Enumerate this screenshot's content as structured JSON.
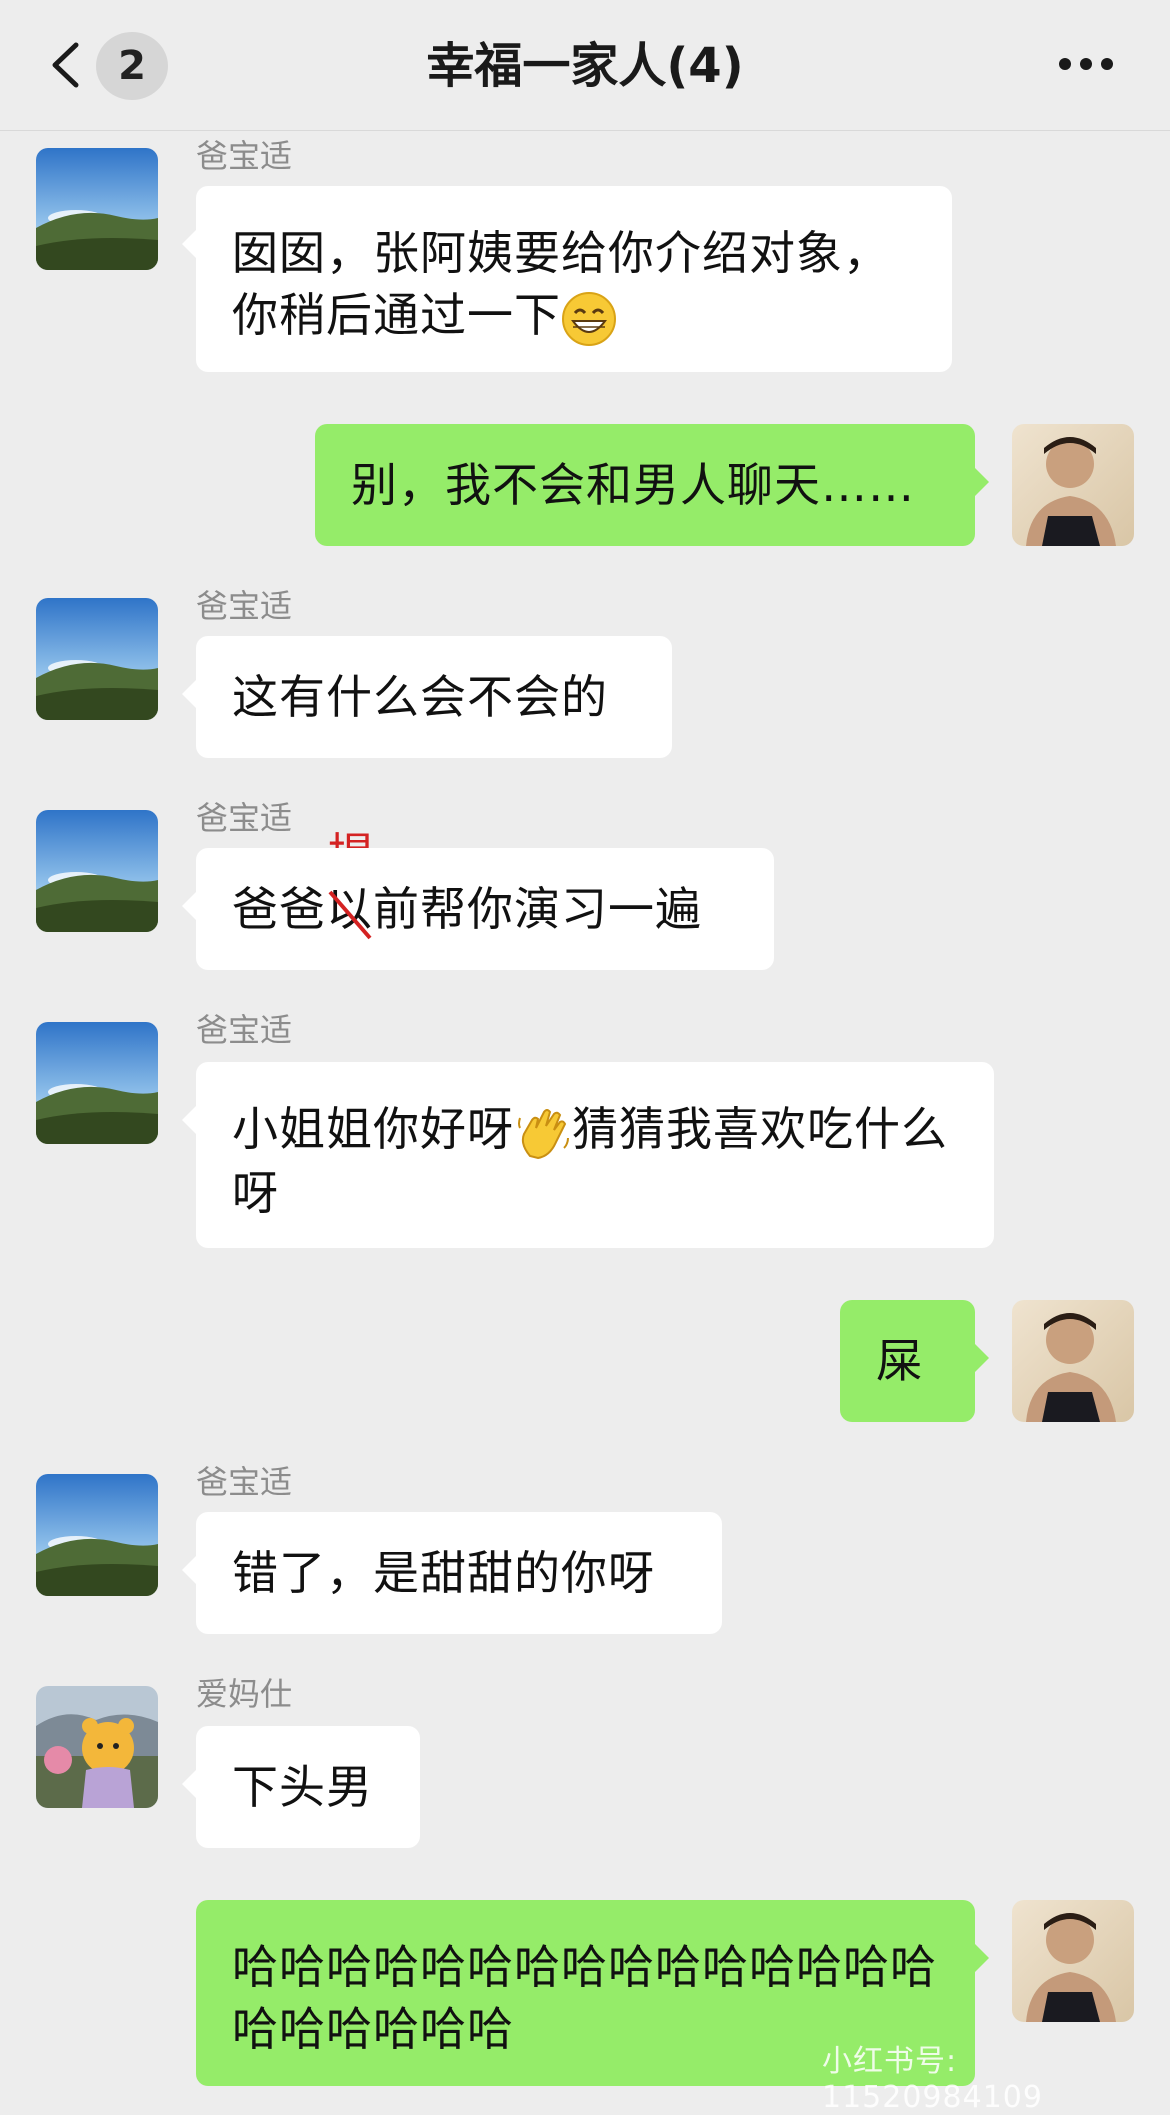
{
  "header": {
    "back_icon": "chevron-left-icon",
    "unread_count": "2",
    "title": "幸福一家人(4)",
    "more_icon": "more-dots-icon"
  },
  "messages": [
    {
      "sender": "爸宝适",
      "text": "囡囡，张阿姨要给你介绍对象，你稍后通过一下",
      "direction": "in",
      "emoji": "grinning-face"
    },
    {
      "sender": "",
      "text": "别，我不会和男人聊天……",
      "direction": "out"
    },
    {
      "sender": "爸宝适",
      "text": "这有什么会不会的",
      "direction": "in"
    },
    {
      "sender": "爸宝适",
      "text_before": "爸爸",
      "struck": "以",
      "text_after": "前帮你演习一遍",
      "correction": "提",
      "direction": "in"
    },
    {
      "sender": "爸宝适",
      "text_before": "小姐姐你好呀",
      "text_after": "猜猜我喜欢吃什么呀",
      "direction": "in",
      "emoji": "waving-hand"
    },
    {
      "sender": "",
      "text": "屎",
      "direction": "out"
    },
    {
      "sender": "爸宝适",
      "text": "错了，是甜甜的你呀",
      "direction": "in"
    },
    {
      "sender": "爱妈仕",
      "text": "下头男",
      "direction": "in"
    },
    {
      "sender": "",
      "text": "哈哈哈哈哈哈哈哈哈哈哈哈哈哈哈哈哈哈哈哈哈",
      "direction": "out"
    }
  ],
  "watermark": "小红书号: 11520984109",
  "colors": {
    "background": "#ededed",
    "outgoing_bubble": "#95ec69",
    "incoming_bubble": "#ffffff",
    "correction": "#d42222"
  }
}
